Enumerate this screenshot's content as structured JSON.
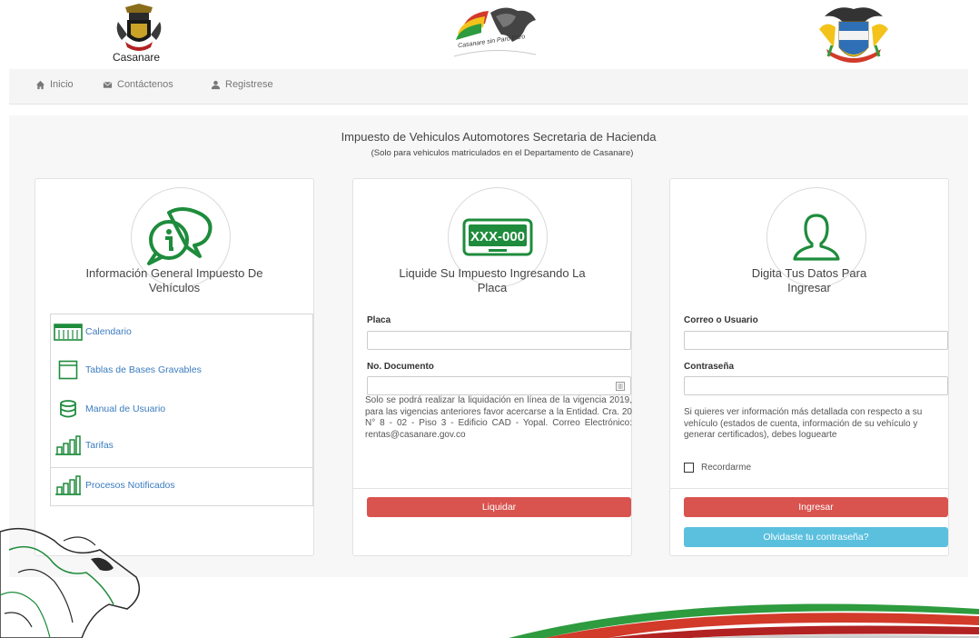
{
  "header": {
    "brand_text": "Casanare",
    "center_logo_text": "Casanare sin Paro Paro"
  },
  "nav": {
    "items": [
      {
        "icon": "home-icon",
        "label": "Inicio"
      },
      {
        "icon": "envelope-icon",
        "label": "Contáctenos"
      },
      {
        "icon": "user-icon",
        "label": "Registrese"
      }
    ]
  },
  "page": {
    "title": "Impuesto de Vehiculos Automotores   Secretaria de Hacienda",
    "subtitle": "(Solo para vehiculos matriculados en el Departamento de Casanare)"
  },
  "info_card": {
    "icon": "info-chat-icon",
    "title": "Información General Impuesto De Vehículos",
    "items": [
      {
        "icon": "calendar-icon",
        "label": "Calendario"
      },
      {
        "icon": "table-icon",
        "label": "Tablas de Bases Gravables"
      },
      {
        "icon": "database-icon",
        "label": "Manual de Usuario"
      },
      {
        "icon": "bar-chart-icon",
        "label": "Tarifas"
      },
      {
        "icon": "bar-chart-icon",
        "label": "Procesos Notificados"
      }
    ]
  },
  "liquidar_card": {
    "icon": "license-plate-icon",
    "plate_text": "XXX-000",
    "title": "Liquide Su Impuesto Ingresando La Placa",
    "placa_label": "Placa",
    "placa_value": "",
    "documento_label": "No. Documento",
    "documento_value": "",
    "note": "Solo se podrá realizar la liquidación en línea de la vigencia 2019, para las vigencias anteriores favor acercarse a la Entidad. Cra. 20 N° 8 - 02 - Piso 3 - Edificio CAD - Yopal. Correo Electrónico: rentas@casanare.gov.co",
    "button": "Liquidar"
  },
  "login_card": {
    "icon": "user-outline-icon",
    "title": "Digita Tus Datos Para Ingresar",
    "user_label": "Correo o Usuario",
    "user_value": "",
    "password_label": "Contraseña",
    "password_value": "",
    "note": "Si quieres ver información más detallada con respecto a su vehículo (estados de cuenta, información de su vehículo y generar certificados), debes loguearte",
    "remember_label": "Recordarme",
    "login_button": "Ingresar",
    "forgot_button": "Olvidaste tu contraseña?"
  },
  "colors": {
    "danger": "#d9534f",
    "info": "#5bc0de",
    "green": "#1e8c3c",
    "link": "#3a7bbf"
  }
}
